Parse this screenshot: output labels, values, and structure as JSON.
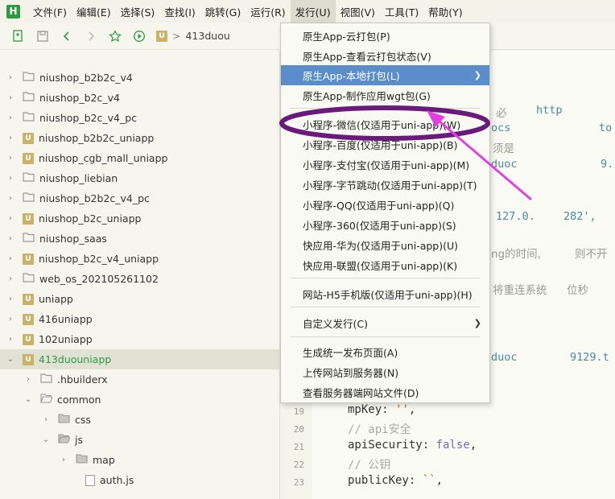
{
  "app": {
    "logo": "H"
  },
  "menubar": [
    {
      "label": "文件(F)"
    },
    {
      "label": "编辑(E)"
    },
    {
      "label": "选择(S)"
    },
    {
      "label": "查找(I)"
    },
    {
      "label": "跳转(G)"
    },
    {
      "label": "运行(R)"
    },
    {
      "label": "发行(U)"
    },
    {
      "label": "视图(V)"
    },
    {
      "label": "工具(T)"
    },
    {
      "label": "帮助(Y)"
    }
  ],
  "toolbar": {
    "path_root": "413duou"
  },
  "sidebar": {
    "items": [
      {
        "label": "niushop_b2b2c_v4",
        "icon": "folder-icon"
      },
      {
        "label": "niushop_b2c_v4",
        "icon": "folder-icon"
      },
      {
        "label": "niushop_b2c_v4_pc",
        "icon": "folder-icon"
      },
      {
        "label": "niushop_b2b2c_uniapp",
        "icon": "uniapp-project-icon"
      },
      {
        "label": "niushop_cgb_mall_uniapp",
        "icon": "uniapp-project-icon"
      },
      {
        "label": "niushop_liebian",
        "icon": "folder-icon"
      },
      {
        "label": "niushop_b2b2c_v4_pc",
        "icon": "folder-icon"
      },
      {
        "label": "niushop_b2c_uniapp",
        "icon": "uniapp-project-icon"
      },
      {
        "label": "niushop_saas",
        "icon": "folder-icon"
      },
      {
        "label": "niushop_b2c_v4_uniapp",
        "icon": "uniapp-project-icon"
      },
      {
        "label": "web_os_202105261102",
        "icon": "folder-icon"
      },
      {
        "label": "uniapp",
        "icon": "uniapp-project-icon"
      },
      {
        "label": "416uniapp",
        "icon": "uniapp-project-icon"
      },
      {
        "label": "102uniapp",
        "icon": "uniapp-project-icon"
      },
      {
        "label": "413duouniapp",
        "icon": "uniapp-project-icon"
      },
      {
        "label": ".hbuilderx",
        "icon": "folder-icon"
      },
      {
        "label": "common",
        "icon": "folder-icon"
      },
      {
        "label": "css",
        "icon": "folder-icon"
      },
      {
        "label": "js",
        "icon": "folder-icon"
      },
      {
        "label": "map",
        "icon": "folder-icon"
      },
      {
        "label": "auth.js",
        "icon": "js-file-icon"
      }
    ]
  },
  "editor": {
    "fragments": [
      "必",
      "http",
      "ocs",
      "to",
      "须是",
      "duoc",
      "9.",
      "127.0.",
      "282',",
      "ng的时间,",
      "则不开",
      "将重连系统",
      "位秒",
      "duoc",
      "9129.t"
    ],
    "lines": [
      {
        "num": "19",
        "key": "mpKey",
        "value": "''",
        "end": ","
      },
      {
        "num": "20",
        "comment": "// api安全"
      },
      {
        "num": "21",
        "key": "apiSecurity",
        "value": "false",
        "end": ","
      },
      {
        "num": "22",
        "comment": "// 公钥"
      },
      {
        "num": "23",
        "key": "publicKey",
        "value": "``",
        "end": ","
      }
    ]
  },
  "dropdown": {
    "group1": [
      {
        "label": "原生App-云打包(P)"
      },
      {
        "label": "原生App-查看云打包状态(V)"
      },
      {
        "label": "原生App-本地打包(L)",
        "submenu": true,
        "highlight": true
      },
      {
        "label": "原生App-制作应用wgt包(G)"
      }
    ],
    "group2": [
      {
        "label": "小程序-微信(仅适用于uni-app)(W)"
      },
      {
        "label": "小程序-百度(仅适用于uni-app)(B)"
      },
      {
        "label": "小程序-支付宝(仅适用于uni-app)(M)"
      },
      {
        "label": "小程序-字节跳动(仅适用于uni-app)(T)"
      },
      {
        "label": "小程序-QQ(仅适用于uni-app)(Q)"
      },
      {
        "label": "小程序-360(仅适用于uni-app)(S)"
      },
      {
        "label": "快应用-华为(仅适用于uni-app)(U)"
      },
      {
        "label": "快应用-联盟(仅适用于uni-app)(K)"
      }
    ],
    "group3": [
      {
        "label": "网站-H5手机版(仅适用于uni-app)(H)"
      }
    ],
    "group4": [
      {
        "label": "自定义发行(C)",
        "submenu": true
      }
    ],
    "group5": [
      {
        "label": "生成统一发布页面(A)"
      },
      {
        "label": "上传网站到服务器(N)"
      },
      {
        "label": "查看服务器端网站文件(D)"
      }
    ]
  },
  "colors": {
    "accent_green": "#2e9a44",
    "menu_highlight": "#5a8dc9",
    "annotation_purple": "#6a1a7a",
    "annotation_arrow": "#e040e0"
  }
}
